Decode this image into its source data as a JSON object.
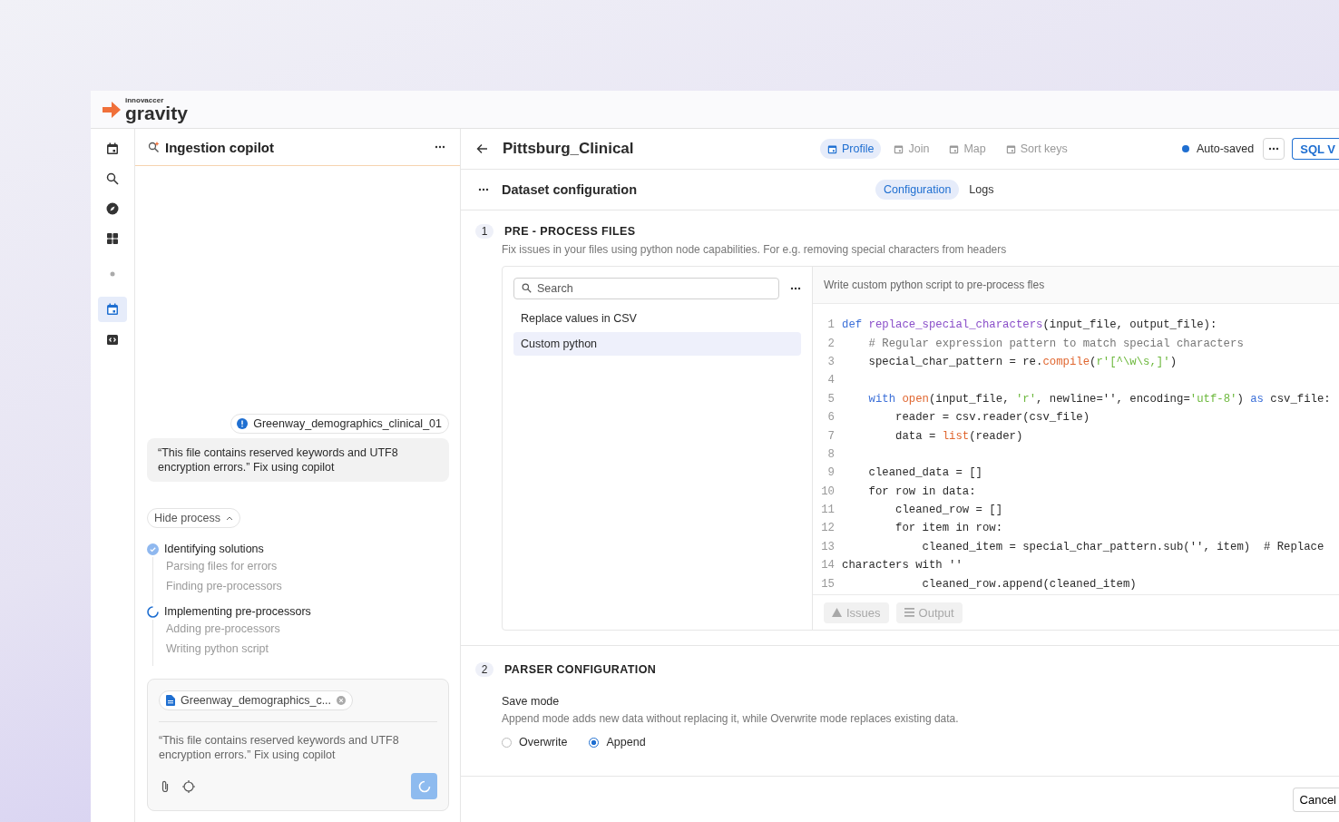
{
  "brand": {
    "company": "innovaccer",
    "product": "gravity"
  },
  "rail": [
    {
      "kind": "calendar",
      "selected": false
    },
    {
      "kind": "search",
      "selected": false
    },
    {
      "kind": "compass",
      "selected": false
    },
    {
      "kind": "grid",
      "selected": false
    },
    {
      "kind": "dot",
      "selected": false
    },
    {
      "kind": "calendar",
      "selected": true
    },
    {
      "kind": "code",
      "selected": false
    }
  ],
  "copilot": {
    "title": "Ingestion copilot",
    "file_chip": "Greenway_demographics_clinical_01",
    "message": "“This file contains reserved keywords and UTF8 encryption errors.” Fix using copilot",
    "toggle": "Hide process",
    "steps": [
      {
        "label": "Identifying solutions",
        "completed": true,
        "children": [
          {
            "label": "Parsing files for errors"
          },
          {
            "label": "Finding pre-processors"
          }
        ]
      },
      {
        "label": "Implementing pre-processors",
        "completed": false,
        "children": [
          {
            "label": "Adding pre-processors"
          },
          {
            "label": "Writing python script"
          }
        ]
      }
    ],
    "composer": {
      "attachment": "Greenway_demographics_c...",
      "value": "“This file contains reserved keywords and UTF8 encryption errors.” Fix using copilot"
    }
  },
  "topbar": {
    "title": "Pittsburg_Clinical",
    "tabs": [
      {
        "label": "Profile",
        "selected": true
      },
      {
        "label": "Join",
        "selected": false
      },
      {
        "label": "Map",
        "selected": false
      },
      {
        "label": "Sort keys",
        "selected": false
      }
    ],
    "status": "Auto-saved",
    "primary": "SQL V"
  },
  "subbar": {
    "title": "Dataset configuration",
    "tabs": [
      {
        "label": "Configuration",
        "selected": true
      },
      {
        "label": "Logs",
        "selected": false
      }
    ]
  },
  "preprocess": {
    "number": "1",
    "title": "PRE - PROCESS FILES",
    "description": "Fix issues in your files using python node capabilities. For e.g. removing special characters from headers",
    "search": {
      "placeholder": "Search"
    },
    "items": [
      {
        "label": "Replace values in CSV",
        "selected": false
      },
      {
        "label": "Custom python",
        "selected": true
      }
    ],
    "editor_title": "Write custom python script to pre-process fles",
    "code": [
      {
        "n": "1",
        "tokens": [
          {
            "kind": "kw",
            "text": "def "
          },
          {
            "kind": "fn",
            "text": "replace_special_characters"
          },
          {
            "kind": "plain",
            "text": "(input_file, output_file):"
          }
        ]
      },
      {
        "n": "2",
        "tokens": [
          {
            "kind": "comment",
            "text": "    # Regular expression pattern to match special characters"
          }
        ]
      },
      {
        "n": "3",
        "tokens": [
          {
            "kind": "plain",
            "text": "    special_char_pattern = re."
          },
          {
            "kind": "builtin",
            "text": "compile"
          },
          {
            "kind": "plain",
            "text": "("
          },
          {
            "kind": "string",
            "text": "r'[^\\w\\s,]'"
          },
          {
            "kind": "plain",
            "text": ")"
          }
        ]
      },
      {
        "n": "4"
      },
      {
        "n": "5",
        "tokens": [
          {
            "kind": "kw",
            "text": "    with "
          },
          {
            "kind": "builtin",
            "text": "open"
          },
          {
            "kind": "plain",
            "text": "(input_file, "
          },
          {
            "kind": "string",
            "text": "'r'"
          },
          {
            "kind": "plain",
            "text": ", newline='', encoding="
          },
          {
            "kind": "string",
            "text": "'utf-8'"
          },
          {
            "kind": "plain",
            "text": ") "
          },
          {
            "kind": "kw",
            "text": "as"
          },
          {
            "kind": "plain",
            "text": " csv_file:"
          }
        ]
      },
      {
        "n": "6",
        "tokens": [
          {
            "kind": "plain",
            "text": "        reader = csv.reader(csv_file)"
          }
        ]
      },
      {
        "n": "7",
        "tokens": [
          {
            "kind": "plain",
            "text": "        data = "
          },
          {
            "kind": "builtin",
            "text": "list"
          },
          {
            "kind": "plain",
            "text": "(reader)"
          }
        ]
      },
      {
        "n": "8"
      },
      {
        "n": "9",
        "tokens": [
          {
            "kind": "plain",
            "text": "    cleaned_data = []"
          }
        ]
      },
      {
        "n": "10",
        "tokens": [
          {
            "kind": "plain",
            "text": "    for row in data:"
          }
        ]
      },
      {
        "n": "11",
        "tokens": [
          {
            "kind": "plain",
            "text": "        cleaned_row = []"
          }
        ]
      },
      {
        "n": "12",
        "tokens": [
          {
            "kind": "plain",
            "text": "        for item in row:"
          }
        ]
      },
      {
        "n": "13",
        "tokens": [
          {
            "kind": "plain",
            "text": "            cleaned_item = special_char_pattern.sub('', item)  # Replace"
          }
        ]
      },
      {
        "n": "14",
        "tokens": [
          {
            "kind": "plain",
            "text": "characters with ''"
          }
        ]
      },
      {
        "n": "15",
        "tokens": [
          {
            "kind": "plain",
            "text": "            cleaned_row.append(cleaned_item)"
          }
        ]
      }
    ],
    "panel_buttons": [
      {
        "kind": "issues",
        "label": "Issues",
        "disabled": true
      },
      {
        "kind": "output",
        "label": "Output",
        "disabled": true
      }
    ]
  },
  "parser": {
    "number": "2",
    "title": "PARSER CONFIGURATION",
    "field": "Save mode",
    "description": "Append mode adds new data without replacing it, while Overwrite mode replaces existing data.",
    "options": [
      {
        "label": "Overwrite",
        "selected": false
      },
      {
        "label": "Append",
        "selected": true
      }
    ]
  },
  "footer": {
    "cancel": "Cancel"
  }
}
